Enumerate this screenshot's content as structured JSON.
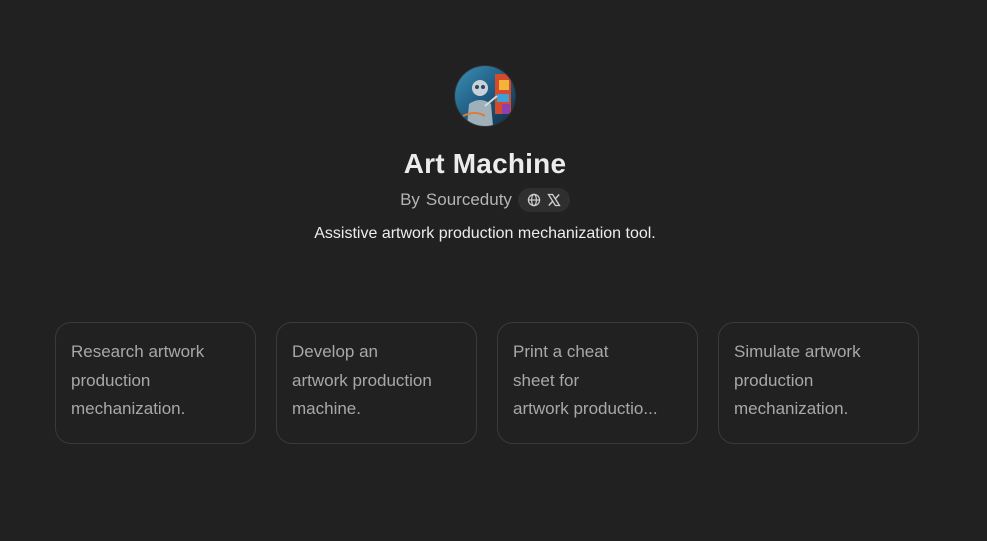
{
  "gpt": {
    "name": "Art Machine",
    "by_prefix": "By",
    "author": "Sourceduty",
    "description": "Assistive artwork production mechanization tool.",
    "social_icons": [
      "globe-icon",
      "x-logo-icon"
    ]
  },
  "starters": [
    {
      "lines": [
        "Research artwork",
        "production",
        "mechanization."
      ]
    },
    {
      "lines": [
        "Develop an",
        "artwork production",
        "machine."
      ]
    },
    {
      "lines": [
        "Print a cheat",
        "sheet for",
        "artwork productio..."
      ]
    },
    {
      "lines": [
        "Simulate artwork",
        "production",
        "mechanization."
      ]
    }
  ],
  "colors": {
    "background": "#212121",
    "text_primary": "#ececec",
    "text_secondary": "#b4b4b4",
    "card_border": "#3a3a3a",
    "pill_background": "#2f2f2f"
  }
}
